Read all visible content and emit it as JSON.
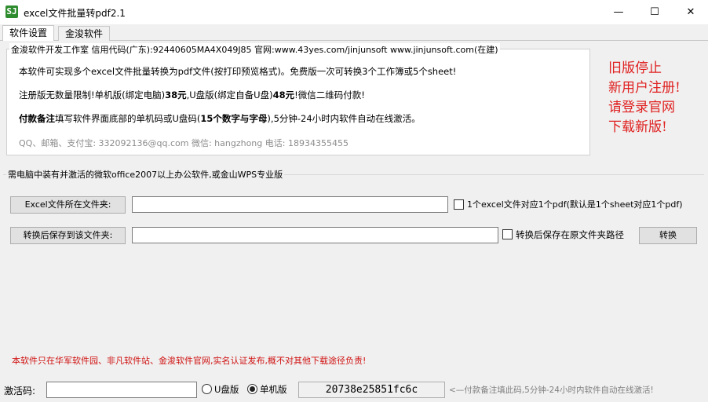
{
  "window": {
    "title": "excel文件批量转pdf2.1",
    "icon_text": "SJ",
    "min_glyph": "—",
    "max_glyph": "☐",
    "close_glyph": "✕"
  },
  "tabs": [
    "软件设置",
    "金浚软件"
  ],
  "info": {
    "legend": "金浚软件开发工作室 信用代码(广东):92440605MA4X049J85 官网:www.43yes.com/jinjunsoft  www.jinjunsoft.com(在建)",
    "line1": "本软件可实现多个excel文件批量转换为pdf文件(按打印预览格式)。免费版一次可转换3个工作簿或5个sheet!",
    "line2_a": "注册版无数量限制!单机版(绑定电脑)",
    "line2_price1": "38元",
    "line2_b": ",U盘版(绑定自备U盘)",
    "line2_price2": "48元",
    "line2_c": "!微信二维码付款!",
    "line3_bold1": "付款备注",
    "line3_a": "填写软件界面底部的单机码或U盘码(",
    "line3_bold2": "15个数字与字母",
    "line3_b": "),5分钟-24小时内软件自动在线激活。",
    "line4": "QQ、邮箱、支付宝: 332092136@qq.com   微信: hangzhong   电话: 18934355455"
  },
  "notice": {
    "line1": "旧版停止",
    "line2": "新用户注册!",
    "line3": "请登录官网",
    "line4": "下载新版!",
    "color": "#e02020"
  },
  "office_group": {
    "legend": "需电脑中装有并激活的微软office2007以上办公软件,或金山WPS专业版"
  },
  "source": {
    "button_label": "Excel文件所在文件夹:",
    "value": "",
    "checkbox_label": "1个excel文件对应1个pdf(默认是1个sheet对应1个pdf)",
    "checked": false
  },
  "dest": {
    "button_label": "转换后保存到该文件夹:",
    "value": "",
    "checkbox_label": "转换后保存在原文件夹路径",
    "checked": false
  },
  "convert_label": "转换",
  "warning": "本软件只在华军软件园、非凡软件站、金浚软件官网,实名认证发布,概不对其他下载途径负责!",
  "bottom": {
    "activation_label": "激活码:",
    "activation_value": "",
    "radio_u_label": "U盘版",
    "radio_single_label": "单机版",
    "selected": "单机版",
    "machine_code": "20738e25851fc6c",
    "hint": "<—付款备注填此码,5分钟-24小时内软件自动在线激活!"
  }
}
